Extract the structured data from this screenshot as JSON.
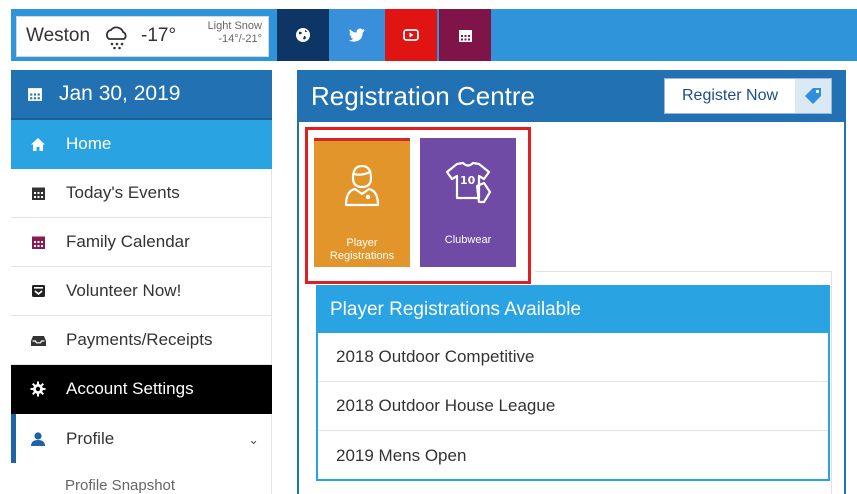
{
  "weather": {
    "city": "Weston",
    "temperature": "-17°",
    "condition": "Light Snow",
    "range": "-14°/-21°",
    "icon": "snow-cloud-icon"
  },
  "social": [
    {
      "icon": "globe-icon",
      "color": "#0d3566"
    },
    {
      "icon": "twitter-icon",
      "color": "#3a8fdb"
    },
    {
      "icon": "youtube-icon",
      "color": "#e11414"
    },
    {
      "icon": "calendar-icon",
      "color": "#7f1448"
    }
  ],
  "sidebar": {
    "date": "Jan 30, 2019",
    "items": [
      {
        "label": "Home",
        "icon": "home-icon"
      },
      {
        "label": "Today's Events",
        "icon": "calendar-icon"
      },
      {
        "label": "Family Calendar",
        "icon": "calendar-icon"
      },
      {
        "label": "Volunteer Now!",
        "icon": "inbox-icon"
      },
      {
        "label": "Payments/Receipts",
        "icon": "tray-icon"
      },
      {
        "label": "Account Settings",
        "icon": "gear-icon"
      },
      {
        "label": "Profile",
        "icon": "user-icon"
      }
    ],
    "sub_items": [
      {
        "label": "Profile Snapshot"
      }
    ]
  },
  "main": {
    "title": "Registration Centre",
    "register_button": "Register Now",
    "tiles": [
      {
        "label": "Player Registrations",
        "icon": "player-icon",
        "color": "#e2952b"
      },
      {
        "label": "Clubwear",
        "icon": "jersey-icon",
        "color": "#6f4ba5"
      }
    ],
    "available": {
      "heading": "Player Registrations Available",
      "rows": [
        "2018 Outdoor Competitive",
        "2018 Outdoor House League",
        "2019 Mens Open"
      ]
    }
  },
  "colors": {
    "primary": "#2171b3",
    "accent": "#29a3e2",
    "highlight_frame": "#e02020"
  }
}
